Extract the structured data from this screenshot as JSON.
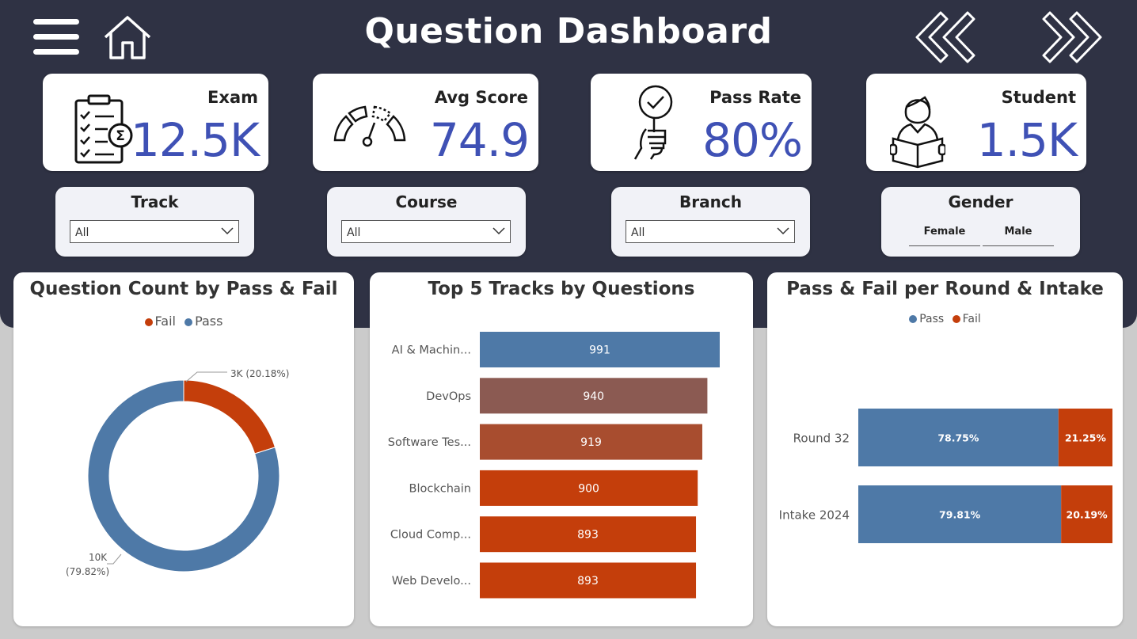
{
  "header": {
    "title": "Question Dashboard"
  },
  "kpis": [
    {
      "label": "Exam",
      "value": "12.5K"
    },
    {
      "label": "Avg Score",
      "value": "74.9"
    },
    {
      "label": "Pass Rate",
      "value": "80%"
    },
    {
      "label": "Student",
      "value": "1.5K"
    }
  ],
  "slicers": {
    "track": {
      "title": "Track",
      "value": "All"
    },
    "course": {
      "title": "Course",
      "value": "All"
    },
    "branch": {
      "title": "Branch",
      "value": "All"
    },
    "gender": {
      "title": "Gender",
      "options": [
        "Female",
        "Male"
      ]
    }
  },
  "colors": {
    "pass": "#4e79a7",
    "fail": "#c43e0b",
    "accent": "#3f51b5",
    "band": "#2f3244"
  },
  "chart_data": [
    {
      "type": "pie",
      "title": "Question Count by Pass & Fail",
      "legend": [
        "Fail",
        "Pass"
      ],
      "categories": [
        "Fail",
        "Pass"
      ],
      "values": [
        20.18,
        79.82
      ],
      "labels": {
        "fail_value": "3K (20.18%)",
        "pass_value": "10K",
        "pass_pct": "(79.82%)"
      }
    },
    {
      "type": "bar",
      "title": "Top 5 Tracks by Questions",
      "categories": [
        "AI & Machin...",
        "DevOps",
        "Software Tes...",
        "Blockchain",
        "Cloud Comp...",
        "Web Develo..."
      ],
      "values": [
        991,
        940,
        919,
        900,
        893,
        893
      ],
      "bar_colors": [
        "#4e79a7",
        "#8b5a52",
        "#a84d2f",
        "#c43e0b",
        "#c43e0b",
        "#c43e0b"
      ]
    },
    {
      "type": "bar",
      "title": "Pass & Fail per Round & Intake",
      "legend": [
        "Pass",
        "Fail"
      ],
      "categories": [
        "Round 32",
        "Intake 2024"
      ],
      "series": [
        {
          "name": "Pass",
          "values": [
            78.75,
            79.81
          ],
          "labels": [
            "78.75%",
            "79.81%"
          ]
        },
        {
          "name": "Fail",
          "values": [
            21.25,
            20.19
          ],
          "labels": [
            "21.25%",
            "20.19%"
          ]
        }
      ]
    }
  ]
}
